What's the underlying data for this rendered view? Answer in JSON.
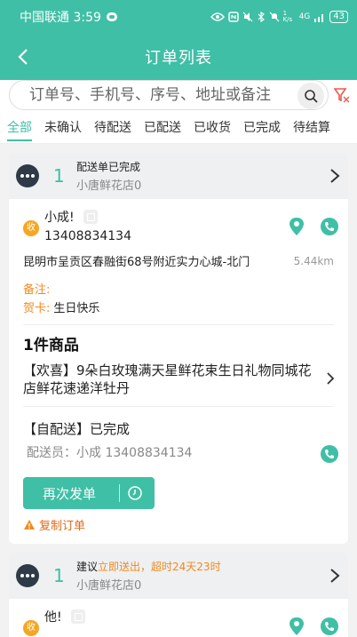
{
  "status_bar": {
    "carrier_time": "中国联通 3:59",
    "net_speed": "1 K/s",
    "signal": "4G",
    "battery": "43"
  },
  "header": {
    "title": "订单列表"
  },
  "search": {
    "placeholder": "订单号、手机号、序号、地址或备注"
  },
  "tabs": [
    "全部",
    "未确认",
    "待配送",
    "已配送",
    "已收货",
    "已完成",
    "待结算"
  ],
  "orders": [
    {
      "seq": "1",
      "status": "配送单已完成",
      "store": "小唐鲜花店0",
      "recv_badge": "收",
      "customer_name": "小成!",
      "customer_phone": "13408834134",
      "address": "昆明市呈贡区春融街68号附近实力心城-北门",
      "distance": "5.44km",
      "note_label": "备注:",
      "card_label": "贺卡:",
      "card_text": "生日快乐",
      "goods_count": "1件商品",
      "goods_item": "【欢喜】9朵白玫瑰满天星鲜花束生日礼物同城花店鲜花速递洋牡丹",
      "delivery_title": "【自配送】已完成",
      "courier": "配送员：小成  13408834134",
      "resend_label": "再次发单",
      "copy_label": "复制订单"
    },
    {
      "seq": "1",
      "suggest_prefix": "建议",
      "suggest_action": "立即送出，",
      "suggest_overdue": "超时24天23时",
      "store": "小唐鲜花店0",
      "recv_badge": "收",
      "customer_name": "他!"
    }
  ],
  "colors": {
    "brand": "#3fbfa6",
    "warn": "#f08a1c",
    "dark": "#2f3a48"
  }
}
